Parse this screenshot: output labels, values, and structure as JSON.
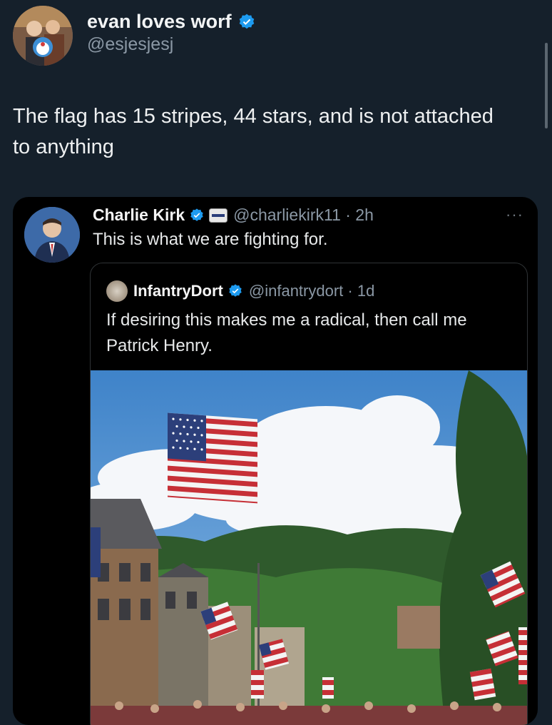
{
  "author": {
    "display_name": "evan loves worf",
    "handle": "@esjesjesj",
    "verified": true,
    "avatar_icon": "avatar-photo-icon"
  },
  "tweet": {
    "text": "The flag has 15 stripes, 44 stars, and is not attached to anything"
  },
  "quoted": {
    "display_name": "Charlie Kirk",
    "handle_time": "@charliekirk11 · 2h",
    "text": "This is what we are fighting for.",
    "more_label": "···",
    "inner_quote": {
      "display_name": "InfantryDort",
      "handle_time": "@infantrydort · 1d",
      "text": "If desiring this makes me a radical, then call me Patrick Henry."
    }
  },
  "colors": {
    "background": "#15202b",
    "card_background": "#000000",
    "verified_blue": "#1d9bf0",
    "muted_text": "#8b98a5"
  }
}
